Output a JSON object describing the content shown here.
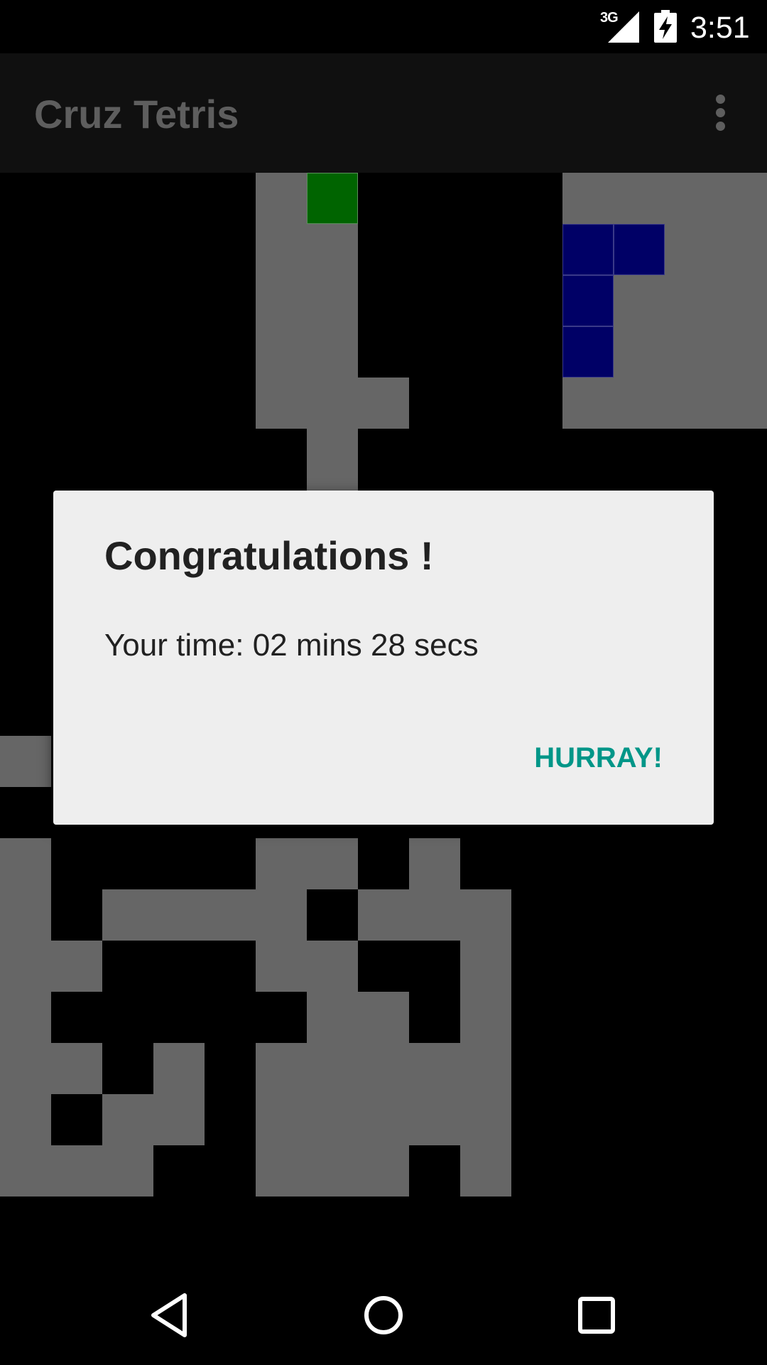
{
  "status_bar": {
    "network_type": "3G",
    "time": "3:51",
    "icons": [
      "signal-icon",
      "battery-charging-icon"
    ]
  },
  "action_bar": {
    "title": "Cruz Tetris",
    "menu_icon": "overflow-menu-icon"
  },
  "board": {
    "columns": 15,
    "cell_color": "#666666",
    "background": "#000000",
    "active_piece_colors": [
      "#006400",
      "#000066"
    ]
  },
  "dialog": {
    "title": "Congratulations !",
    "message": "Your time: 02 mins 28 secs",
    "button_label": "HURRAY!",
    "accent_color": "#009688"
  },
  "nav_bar": {
    "icons": [
      "back-icon",
      "home-icon",
      "recents-icon"
    ]
  }
}
